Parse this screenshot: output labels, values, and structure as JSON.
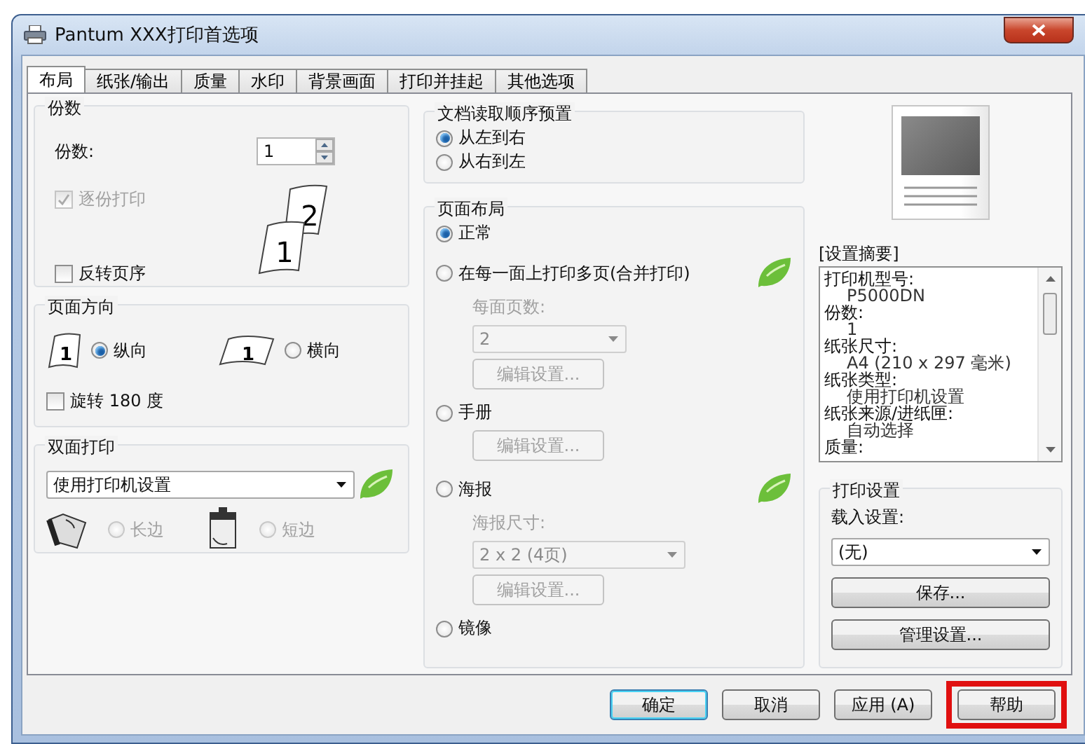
{
  "window": {
    "title": "Pantum XXX打印首选项"
  },
  "tabs": [
    {
      "label": "布局",
      "selected": true
    },
    {
      "label": "纸张/输出",
      "selected": false
    },
    {
      "label": "质量",
      "selected": false
    },
    {
      "label": "水印",
      "selected": false
    },
    {
      "label": "背景画面",
      "selected": false
    },
    {
      "label": "打印并挂起",
      "selected": false
    },
    {
      "label": "其他选项",
      "selected": false
    }
  ],
  "copies": {
    "title": "份数",
    "label": "份数:",
    "value": "1",
    "page_numbers": [
      "2",
      "1"
    ],
    "collate": {
      "label": "逐份打印",
      "checked": true,
      "disabled": true
    },
    "reverse": {
      "label": "反转页序",
      "checked": false,
      "disabled": false
    }
  },
  "orientation": {
    "title": "页面方向",
    "options": [
      {
        "label": "纵向",
        "selected": true,
        "kind": "portrait",
        "icon_text": "1"
      },
      {
        "label": "横向",
        "selected": false,
        "kind": "landscape",
        "icon_text": "1"
      }
    ],
    "rotate": {
      "label": "旋转 180 度",
      "checked": false,
      "disabled": false
    }
  },
  "duplex": {
    "title": "双面打印",
    "value": "使用打印机设置",
    "options": [
      {
        "label": "长边",
        "selected": false,
        "disabled": true,
        "kind": "long"
      },
      {
        "label": "短边",
        "selected": false,
        "disabled": true,
        "kind": "short"
      }
    ]
  },
  "read_order": {
    "title": "文档读取顺序预置",
    "options": [
      {
        "label": "从左到右",
        "selected": true
      },
      {
        "label": "从右到左",
        "selected": false
      }
    ]
  },
  "page_layout": {
    "title": "页面布局",
    "options": [
      {
        "label": "正常",
        "selected": true
      },
      {
        "label": "在每一面上打印多页(合并打印)",
        "selected": false,
        "sub_label": "每面页数:",
        "dropdown": "2",
        "button": "编辑设置...",
        "settings_disabled": true
      },
      {
        "label": "手册",
        "selected": false,
        "button": "编辑设置...",
        "settings_disabled": true
      },
      {
        "label": "海报",
        "selected": false,
        "sub_label": "海报尺寸:",
        "dropdown": "2 x 2 (4页)",
        "button": "编辑设置...",
        "settings_disabled": true
      },
      {
        "label": "镜像",
        "selected": false
      }
    ]
  },
  "summary": {
    "title": "[设置摘要]",
    "lines": [
      {
        "text": "打印机型号:",
        "kind": "key"
      },
      {
        "text": "P5000DN",
        "kind": "value"
      },
      {
        "text": "份数:",
        "kind": "key"
      },
      {
        "text": "1",
        "kind": "value"
      },
      {
        "text": "纸张尺寸:",
        "kind": "key"
      },
      {
        "text": "A4 (210 x 297 毫米)",
        "kind": "value"
      },
      {
        "text": "纸张类型:",
        "kind": "key"
      },
      {
        "text": "使用打印机设置",
        "kind": "value"
      },
      {
        "text": "纸张来源/进纸匣:",
        "kind": "key"
      },
      {
        "text": "自动选择",
        "kind": "value"
      },
      {
        "text": "质量:",
        "kind": "key"
      }
    ]
  },
  "print_settings": {
    "title": "打印设置",
    "load_label": "载入设置:",
    "value": "(无)",
    "buttons": [
      "保存...",
      "管理设置..."
    ]
  },
  "footer_buttons": [
    {
      "label": "确定",
      "default": true,
      "highlighted": false
    },
    {
      "label": "取消",
      "default": false,
      "highlighted": false
    },
    {
      "label": "应用 (A)",
      "default": false,
      "highlighted": false
    },
    {
      "label": "帮助",
      "default": false,
      "highlighted": true
    }
  ]
}
